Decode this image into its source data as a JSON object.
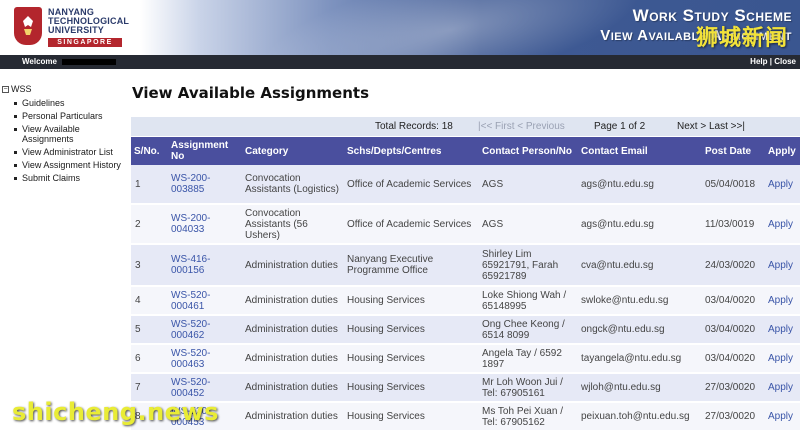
{
  "banner": {
    "uni_line1": "NANYANG",
    "uni_line2": "TECHNOLOGICAL",
    "uni_line3": "UNIVERSITY",
    "uni_line4": "SINGAPORE",
    "title_line1": "Work Study Scheme",
    "title_line2": "View Available Assignment"
  },
  "watermarks": {
    "top": "狮城新闻",
    "bottom": "shicheng.news"
  },
  "topbar": {
    "welcome": "Welcome",
    "help": "Help",
    "separator": " | ",
    "close": "Close"
  },
  "sidebar": {
    "root": "WSS",
    "items": [
      {
        "label": "Guidelines"
      },
      {
        "label": "Personal Particulars"
      },
      {
        "label": "View Available Assignments"
      },
      {
        "label": "View Administrator List"
      },
      {
        "label": "View Assignment History"
      },
      {
        "label": "Submit Claims"
      }
    ]
  },
  "main": {
    "title": "View Available Assignments",
    "total_records": "Total Records: 18",
    "prev_nav": "|<< First < Previous",
    "page_info": "Page 1 of 2",
    "next_nav": "Next > Last >>|",
    "headers": [
      "S/No.",
      "Assignment No",
      "Category",
      "Schs/Depts/Centres",
      "Contact Person/No",
      "Contact Email",
      "Post Date",
      "Apply"
    ],
    "rows": [
      [
        "1",
        "WS-200-003885",
        "Convocation Assistants (Logistics)",
        "Office of Academic Services",
        "AGS",
        "ags@ntu.edu.sg",
        "05/04/0018",
        "Apply"
      ],
      [
        "2",
        "WS-200-004033",
        "Convocation Assistants (56 Ushers)",
        "Office of Academic Services",
        "AGS",
        "ags@ntu.edu.sg",
        "11/03/0019",
        "Apply"
      ],
      [
        "3",
        "WS-416-000156",
        "Administration duties",
        "Nanyang Executive Programme Office",
        "Shirley Lim 65921791, Farah 65921789",
        "cva@ntu.edu.sg",
        "24/03/0020",
        "Apply"
      ],
      [
        "4",
        "WS-520-000461",
        "Administration duties",
        "Housing Services",
        "Loke Shiong Wah / 65148995",
        "swloke@ntu.edu.sg",
        "03/04/0020",
        "Apply"
      ],
      [
        "5",
        "WS-520-000462",
        "Administration duties",
        "Housing Services",
        "Ong Chee Keong / 6514 8099",
        "ongck@ntu.edu.sg",
        "03/04/0020",
        "Apply"
      ],
      [
        "6",
        "WS-520-000463",
        "Administration duties",
        "Housing Services",
        "Angela Tay / 6592 1897",
        "tayangela@ntu.edu.sg",
        "03/04/0020",
        "Apply"
      ],
      [
        "7",
        "WS-520-000452",
        "Administration duties",
        "Housing Services",
        "Mr Loh Woon Jui / Tel: 67905161",
        "wjloh@ntu.edu.sg",
        "27/03/0020",
        "Apply"
      ],
      [
        "8",
        "WS-520-000453",
        "Administration duties",
        "Housing Services",
        "Ms Toh Pei Xuan / Tel: 67905162",
        "peixuan.toh@ntu.edu.sg",
        "27/03/0020",
        "Apply"
      ]
    ]
  }
}
